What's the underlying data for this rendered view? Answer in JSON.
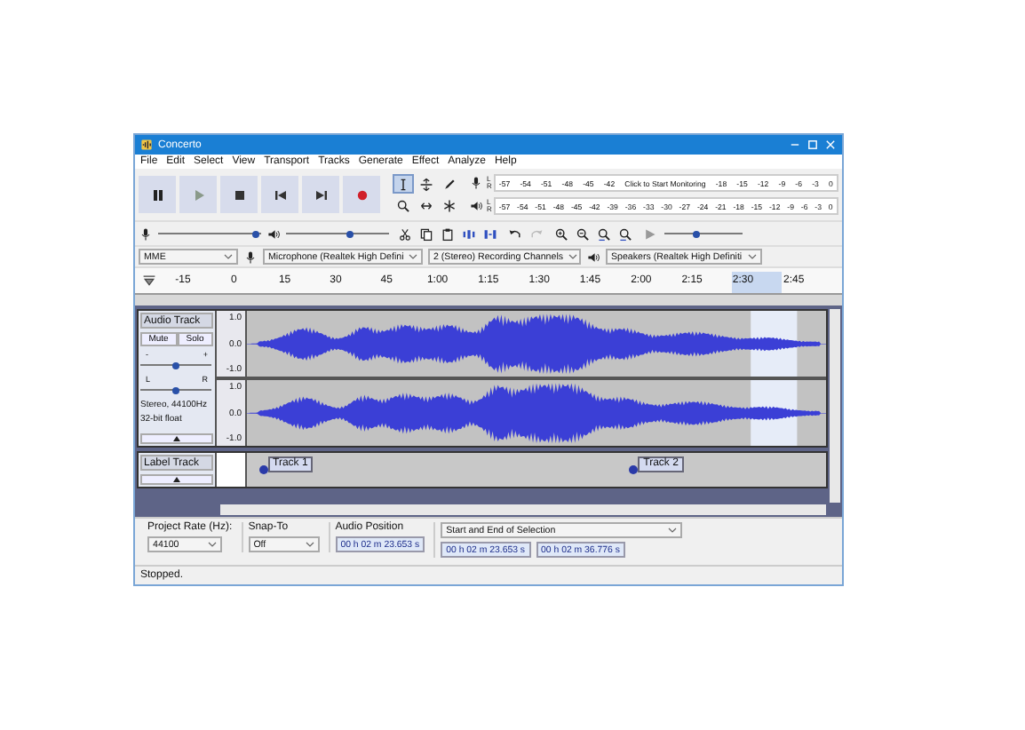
{
  "window": {
    "title": "Concerto"
  },
  "menu": [
    "File",
    "Edit",
    "Select",
    "View",
    "Transport",
    "Tracks",
    "Generate",
    "Effect",
    "Analyze",
    "Help"
  ],
  "transport": [
    {
      "kind": "pause"
    },
    {
      "kind": "play"
    },
    {
      "kind": "stop"
    },
    {
      "kind": "skip-start"
    },
    {
      "kind": "skip-end"
    },
    {
      "kind": "record"
    }
  ],
  "tools": [
    {
      "kind": "select",
      "selected": true
    },
    {
      "kind": "envelope",
      "selected": false
    },
    {
      "kind": "draw",
      "selected": false
    },
    {
      "kind": "zoom",
      "selected": false
    },
    {
      "kind": "time-shift",
      "selected": false
    },
    {
      "kind": "multi",
      "selected": false
    }
  ],
  "meters": [
    {
      "kind": "record",
      "channels": [
        "L",
        "R"
      ],
      "ticks_before": [
        "-57",
        "-54",
        "-51",
        "-48",
        "-45",
        "-42"
      ],
      "message": "Click to Start Monitoring",
      "ticks_after": [
        "-18",
        "-15",
        "-12",
        "-9",
        "-6",
        "-3",
        "0"
      ]
    },
    {
      "kind": "playback",
      "channels": [
        "L",
        "R"
      ],
      "ticks_before": [
        "-57",
        "-54",
        "-51",
        "-48",
        "-45",
        "-42",
        "-39",
        "-36",
        "-33",
        "-30",
        "-27",
        "-24",
        "-21",
        "-18",
        "-15",
        "-12",
        "-9",
        "-6",
        "-3",
        "0"
      ]
    }
  ],
  "mixer": {
    "record_volume": {
      "level": 0.95
    },
    "playback_volume": {
      "level": 0.62
    }
  },
  "edit_tools": [
    {
      "kind": "cut"
    },
    {
      "kind": "copy"
    },
    {
      "kind": "paste"
    },
    {
      "kind": "trim"
    },
    {
      "kind": "silence"
    }
  ],
  "history": [
    {
      "kind": "undo",
      "disabled": false
    },
    {
      "kind": "redo",
      "disabled": true
    }
  ],
  "zoom_tools": [
    {
      "kind": "zoom-in"
    },
    {
      "kind": "zoom-out"
    },
    {
      "kind": "fit-selection"
    },
    {
      "kind": "fit-project"
    }
  ],
  "play_at_speed": {
    "level": 0.4
  },
  "devices": [
    {
      "kind": "host",
      "label": "MME"
    },
    {
      "kind": "input",
      "label": "Microphone (Realtek High Defini"
    },
    {
      "kind": "channels",
      "label": "2 (Stereo) Recording Channels"
    },
    {
      "kind": "output",
      "label": "Speakers (Realtek High Definiti"
    }
  ],
  "timeline": {
    "ticks": [
      "-15",
      "0",
      "15",
      "30",
      "45",
      "1:00",
      "1:15",
      "1:30",
      "1:45",
      "2:00",
      "2:15",
      "2:30",
      "2:45"
    ]
  },
  "audio_track": {
    "name": "Audio Track",
    "buttons": [
      "Mute",
      "Solo"
    ],
    "gain": {
      "level": 0.5,
      "min": "-",
      "max": "+"
    },
    "pan": {
      "level": 0.5,
      "min": "L",
      "max": "R"
    },
    "info": [
      "Stereo, 44100Hz",
      "32-bit float"
    ],
    "channels": [
      {
        "scale": [
          "1.0",
          "0.0",
          "-1.0"
        ]
      },
      {
        "scale": [
          "1.0",
          "0.0",
          "-1.0"
        ]
      }
    ]
  },
  "label_track": {
    "name": "Label Track",
    "labels": [
      "Track 1",
      "Track 2"
    ]
  },
  "selection_toolbar": {
    "project_rate": {
      "label": "Project Rate (Hz):",
      "value": "44100"
    },
    "snap_to": {
      "label": "Snap-To",
      "value": "Off"
    },
    "audio_position": {
      "label": "Audio Position",
      "value": "00 h 02 m 23.653 s"
    },
    "selection": {
      "label": "Start and End of Selection",
      "start": "00 h 02 m 23.653 s",
      "end": "00 h 02 m 36.776 s"
    }
  },
  "status_bar": {
    "text": "Stopped."
  }
}
